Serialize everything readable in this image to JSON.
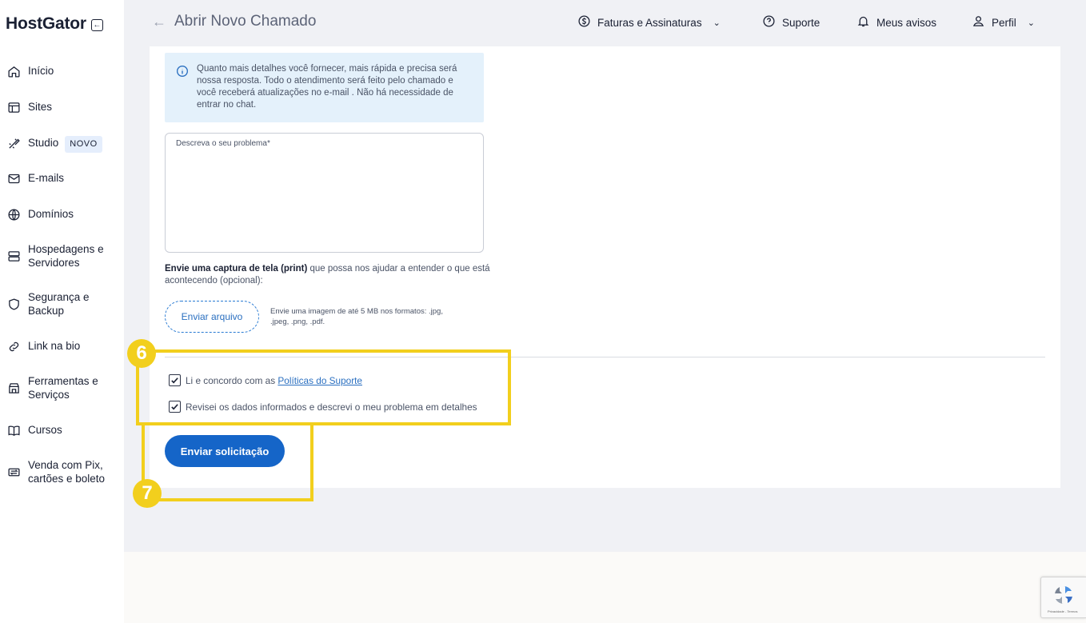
{
  "brand": {
    "name": "HostGator"
  },
  "sidebar": {
    "items": [
      {
        "label": "Início",
        "icon": "home-icon"
      },
      {
        "label": "Sites",
        "icon": "layout-icon"
      },
      {
        "label": "Studio",
        "icon": "studio-icon",
        "badge": "NOVO"
      },
      {
        "label": "E-mails",
        "icon": "mail-icon"
      },
      {
        "label": "Domínios",
        "icon": "globe-icon"
      },
      {
        "label": "Hospedagens e Servidores",
        "icon": "server-icon"
      },
      {
        "label": "Segurança e Backup",
        "icon": "shield-icon"
      },
      {
        "label": "Link na bio",
        "icon": "link-icon"
      },
      {
        "label": "Ferramentas e Serviços",
        "icon": "store-icon"
      },
      {
        "label": "Cursos",
        "icon": "book-icon"
      },
      {
        "label": "Venda com Pix, cartões e boleto",
        "icon": "transfer-icon"
      }
    ]
  },
  "header": {
    "title": "Abrir Novo Chamado",
    "menu": {
      "billing": "Faturas e Assinaturas",
      "support": "Suporte",
      "notices": "Meus avisos",
      "profile": "Perfil"
    }
  },
  "form": {
    "info_text": "Quanto mais detalhes você fornecer, mais rápida e precisa será nossa resposta. Todo o atendimento será feito pelo chamado e você receberá atualizações no e-mail . Não há necessidade de entrar no chat.",
    "description_placeholder": "Descreva o seu problema*",
    "upload_bold": "Envie uma captura de tela (print)",
    "upload_rest": " que possa nos ajudar a entender o que está acontecendo (opcional):",
    "upload_button": "Enviar arquivo",
    "upload_hint": "Envie uma imagem de até 5 MB nos formatos: .jpg, .jpeg, .png, .pdf.",
    "agree_prefix": "Li e concordo com as ",
    "agree_link": "Políticas do Suporte",
    "agree_checked": true,
    "review_label": "Revisei os dados informados e descrevi o meu problema em detalhes",
    "review_checked": true,
    "submit": "Enviar solicitação"
  },
  "annotations": {
    "step_a": "6",
    "step_b": "7",
    "color": "#f2cf1d"
  },
  "colors": {
    "primary": "#1565c8",
    "info_bg": "#e4f1fb",
    "page_bg": "#f0f1f5"
  }
}
